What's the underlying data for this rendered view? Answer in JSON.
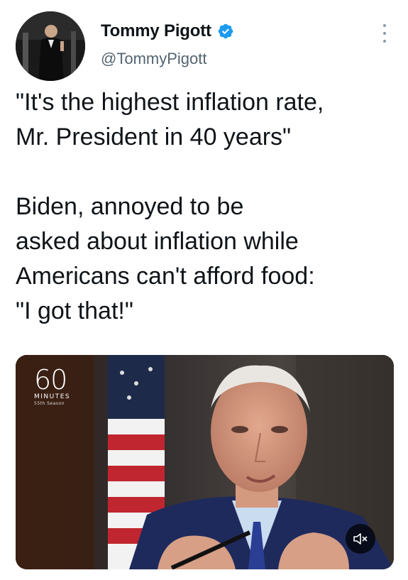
{
  "author": {
    "display_name": "Tommy Pigott",
    "handle": "@TommyPigott",
    "verified": true,
    "verified_color": "#1d9bf0"
  },
  "tweet": {
    "paragraph1_line1": "\"It's the highest inflation rate,",
    "paragraph1_line2": "Mr. President in 40 years\"",
    "paragraph2_line1": "Biden, annoyed to be",
    "paragraph2_line2": "asked about inflation while",
    "paragraph2_line3": "Americans can't afford food:",
    "paragraph2_line4": "\"I got that!\""
  },
  "media": {
    "logo_number": "60",
    "logo_title": "MINUTES",
    "logo_subtitle": "55th Season",
    "mute_icon": "speaker-muted-icon"
  },
  "icons": {
    "more": "more-options-icon",
    "verified": "verified-badge-icon"
  }
}
